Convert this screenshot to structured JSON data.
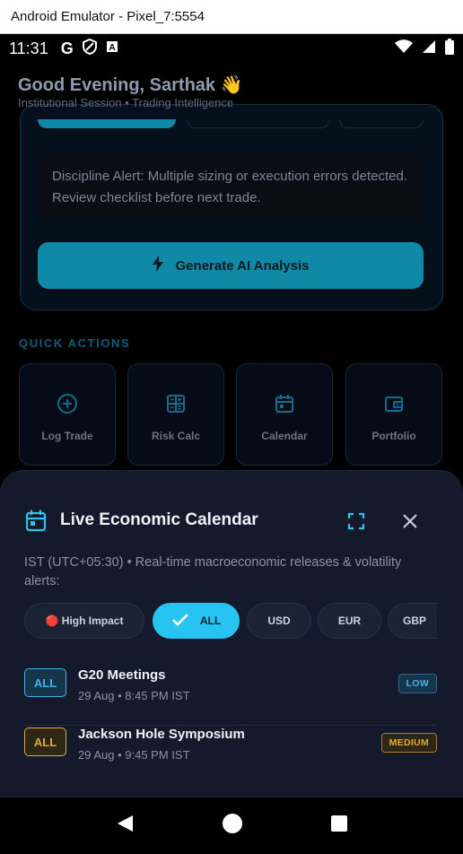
{
  "window": {
    "title": "Android Emulator - Pixel_7:5554"
  },
  "status_bar": {
    "time": "11:31"
  },
  "header": {
    "greeting": "Good Evening, Sarthak 👋",
    "session": "Institutional Session • Trading Intelligence"
  },
  "analysis_card": {
    "alert_text": "Discipline Alert: Multiple sizing or execution errors detected. Review checklist before next trade.",
    "generate_label": "Generate AI Analysis"
  },
  "quick_actions": {
    "heading": "QUICK ACTIONS",
    "items": [
      {
        "label": "Log Trade",
        "icon": "plus-circle-icon"
      },
      {
        "label": "Risk Calc",
        "icon": "calculator-icon"
      },
      {
        "label": "Calendar",
        "icon": "calendar-icon"
      },
      {
        "label": "Portfolio",
        "icon": "wallet-icon"
      }
    ]
  },
  "calendar_sheet": {
    "title": "Live Economic Calendar",
    "subtitle": "IST (UTC+05:30) • Real-time macroeconomic releases & volatility alerts:",
    "filters": [
      {
        "label": "🔴 High Impact",
        "active": false
      },
      {
        "label": "ALL",
        "active": true
      },
      {
        "label": "USD",
        "active": false
      },
      {
        "label": "EUR",
        "active": false
      },
      {
        "label": "GBP",
        "active": false
      }
    ],
    "events": [
      {
        "currency": "ALL",
        "title": "G20 Meetings",
        "time": "29 Aug • 8:45 PM IST",
        "impact": "LOW"
      },
      {
        "currency": "ALL",
        "title": "Jackson Hole Symposium",
        "time": "29 Aug • 9:45 PM IST",
        "impact": "MEDIUM"
      }
    ]
  },
  "colors": {
    "accent": "#27c4f2",
    "low": "#3fb6e6",
    "medium": "#e0a93a",
    "sheet_bg": "#141a2b"
  }
}
